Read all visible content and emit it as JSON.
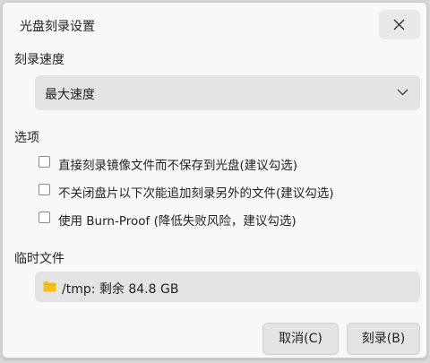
{
  "dialog": {
    "title": "光盘刻录设置"
  },
  "speed": {
    "label": "刻录速度",
    "selected": "最大速度"
  },
  "options": {
    "label": "选项",
    "items": [
      {
        "label": "直接刻录镜像文件而不保存到光盘(建议勾选)",
        "checked": false
      },
      {
        "label": "不关闭盘片以下次能追加刻录另外的文件(建议勾选)",
        "checked": false
      },
      {
        "label": "使用 Burn-Proof (降低失败风险，建议勾选)",
        "checked": false
      }
    ]
  },
  "temp": {
    "label": "临时文件",
    "path": "/tmp: 剩余 84.8 GB",
    "folder_icon_color": "#f5c211"
  },
  "buttons": {
    "cancel": "取消(C)",
    "burn": "刻录(B)"
  }
}
